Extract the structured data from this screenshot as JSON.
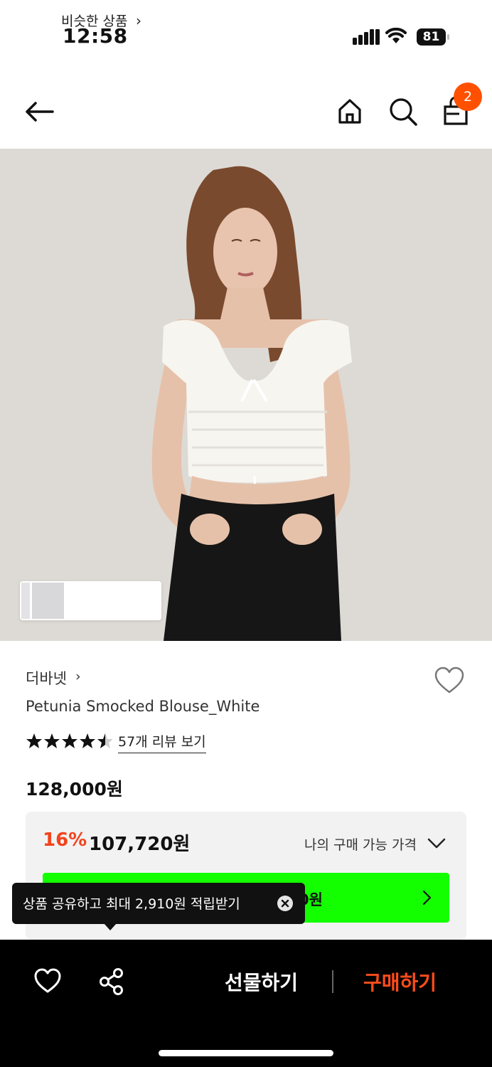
{
  "status_bar": {
    "time": "12:58",
    "battery": "81"
  },
  "nav": {
    "cart_count": "2"
  },
  "hero": {
    "similar_label": "비슷한 상품"
  },
  "product": {
    "brand": "더바넷",
    "name": "Petunia Smocked Blouse_White",
    "rating_stars": 4.5,
    "review_link": "57개 리뷰 보기",
    "original_price": "128,000원",
    "discount_percent": "16%",
    "discount_price": "107,720원",
    "my_price_label": "나의 구매 가능 가격",
    "coupon_text_visible": "0원"
  },
  "tooltip": {
    "text": "상품 공유하고 최대 2,910원 적립받기"
  },
  "bottom_bar": {
    "gift_label": "선물하기",
    "buy_label": "구매하기"
  },
  "colors": {
    "accent_orange": "#ff5000",
    "discount_red": "#f2441d",
    "coupon_green": "#13ff00",
    "buy_orange": "#ff4d1a"
  }
}
